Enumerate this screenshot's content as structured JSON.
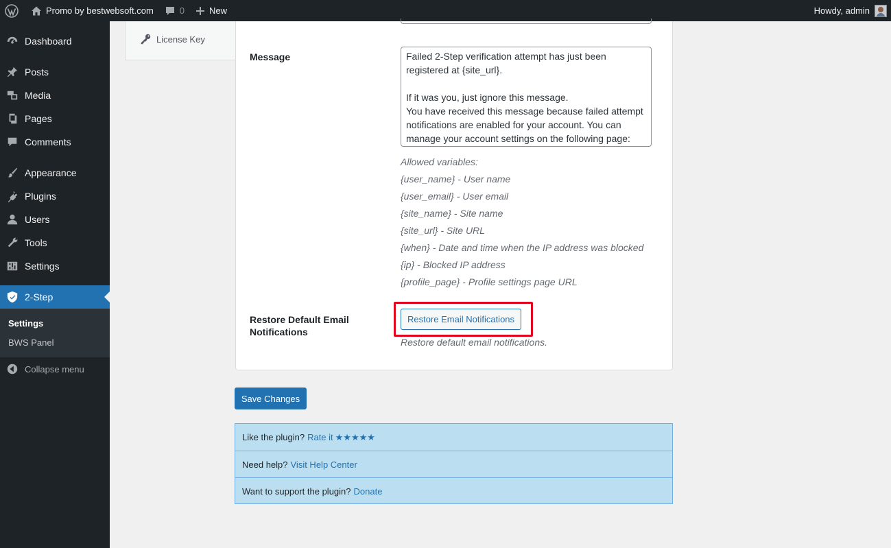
{
  "adminbar": {
    "site_name": "Promo by bestwebsoft.com",
    "comments_count": "0",
    "new_label": "New",
    "howdy": "Howdy, admin"
  },
  "sidebar": {
    "items": [
      {
        "label": "Dashboard",
        "icon": "dashboard-icon"
      },
      {
        "label": "Posts",
        "icon": "pin-icon"
      },
      {
        "label": "Media",
        "icon": "media-icon"
      },
      {
        "label": "Pages",
        "icon": "pages-icon"
      },
      {
        "label": "Comments",
        "icon": "comment-icon"
      },
      {
        "label": "Appearance",
        "icon": "brush-icon"
      },
      {
        "label": "Plugins",
        "icon": "plug-icon"
      },
      {
        "label": "Users",
        "icon": "user-icon"
      },
      {
        "label": "Tools",
        "icon": "wrench-icon"
      },
      {
        "label": "Settings",
        "icon": "sliders-icon"
      },
      {
        "label": "2-Step",
        "icon": "shield-icon"
      }
    ],
    "submenu": [
      "Settings",
      "BWS Panel"
    ],
    "collapse_label": "Collapse menu"
  },
  "tabs": {
    "license_key": "License Key"
  },
  "form": {
    "message_label": "Message",
    "message_text": "Failed 2-Step verification attempt has just been registered at {site_url}.\n\nIf it was you, just ignore this message.\nYou have received this message because failed attempt notifications are enabled for your account. You can manage your account settings on the following page:",
    "variables": [
      "Allowed variables:",
      "{user_name} - User name",
      "{user_email} - User email",
      "{site_name} - Site name",
      "{site_url} - Site URL",
      "{when} - Date and time when the IP address was blocked",
      "{ip} - Blocked IP address",
      "{profile_page} - Profile settings page URL"
    ],
    "restore_label": "Restore Default Email Notifications",
    "restore_button": "Restore Email Notifications",
    "restore_desc": "Restore default email notifications."
  },
  "save_button": "Save Changes",
  "info": {
    "rate_text": "Like the plugin?",
    "rate_link": "Rate it",
    "stars": "★★★★★",
    "help_text": "Need help?",
    "help_link": "Visit Help Center",
    "support_text": "Want to support the plugin?",
    "support_link": "Donate"
  },
  "colors": {
    "admin_dark": "#1d2327",
    "accent": "#2271b1",
    "highlight_red": "#e0071e",
    "info_bg": "#bbdff0"
  }
}
